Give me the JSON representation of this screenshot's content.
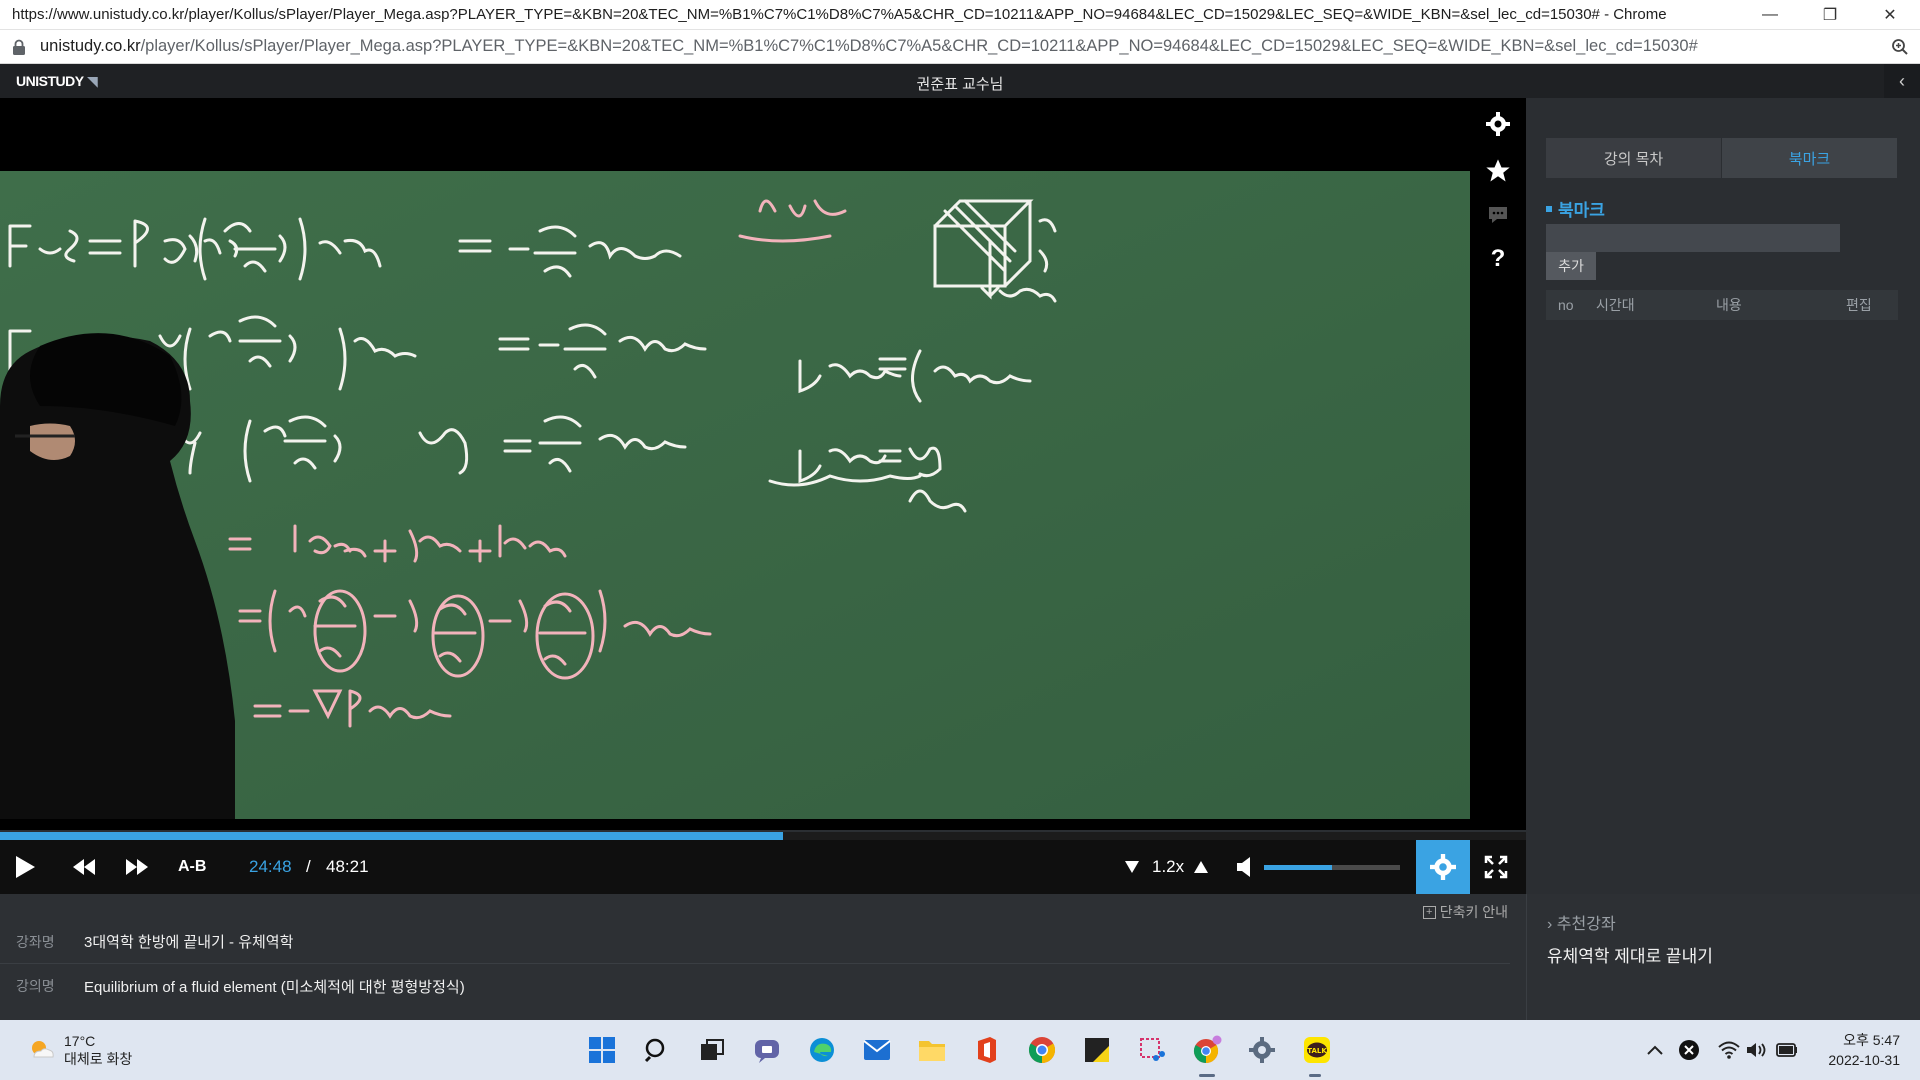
{
  "window": {
    "title": "https://www.unistudy.co.kr/player/Kollus/sPlayer/Player_Mega.asp?PLAYER_TYPE=&KBN=20&TEC_NM=%B1%C7%C1%D8%C7%A5&CHR_CD=10211&APP_NO=94684&LEC_CD=15029&LEC_SEQ=&WIDE_KBN=&sel_lec_cd=15030# - Chrome",
    "minimize": "—",
    "restore": "❐",
    "close": "✕"
  },
  "address": {
    "host": "unistudy.co.kr",
    "path": "/player/Kollus/sPlayer/Player_Mega.asp?PLAYER_TYPE=&KBN=20&TEC_NM=%B1%C7%C1%D8%C7%A5&CHR_CD=10211&APP_NO=94684&LEC_CD=15029&LEC_SEQ=&WIDE_KBN=&sel_lec_cd=15030#"
  },
  "header": {
    "logo": "UNISTUDY",
    "professor": "권준표 교수님",
    "collapse_icon": "chevron-left-icon"
  },
  "player": {
    "ab_label": "A-B",
    "current_time": "24:48",
    "separator": "/",
    "total_time": "48:21",
    "progress": 0.513,
    "speed": "1.2x",
    "volume": 0.5,
    "accent": "#3aa3e3",
    "side_tools": [
      "gear-icon",
      "star-icon",
      "chat-icon",
      "help-icon"
    ],
    "help_glyph": "?"
  },
  "info": {
    "shortcut_label": "단축키 안내",
    "course_key": "강좌명",
    "course_value": "3대역학 한방에 끝내기 - 유체역학",
    "lecture_key": "강의명",
    "lecture_value": "Equilibrium of a fluid element (미소체적에 대한 평형방정식)"
  },
  "panel": {
    "tabs": [
      {
        "label": "강의 목차",
        "active": false
      },
      {
        "label": "북마크",
        "active": true
      }
    ],
    "bookmark_title": "북마크",
    "add_label": "추가",
    "columns": [
      "no",
      "시간대",
      "내용",
      "편집"
    ],
    "recommend_label": "추천강좌",
    "recommend_item": "유체역학 제대로 끝내기"
  },
  "taskbar": {
    "temperature": "17°C",
    "weather_desc": "대체로 화창",
    "time": "오후 5:47",
    "date": "2022-10-31",
    "apps": [
      "windows-start-icon",
      "search-icon",
      "task-view-icon",
      "teams-chat-icon",
      "edge-icon",
      "mail-icon",
      "file-explorer-icon",
      "office-icon",
      "chrome-icon",
      "sticky-notes-icon",
      "snipping-tool-icon",
      "chrome-profile-icon",
      "settings-icon",
      "kakaotalk-icon"
    ],
    "kakao_label": "TALK"
  }
}
